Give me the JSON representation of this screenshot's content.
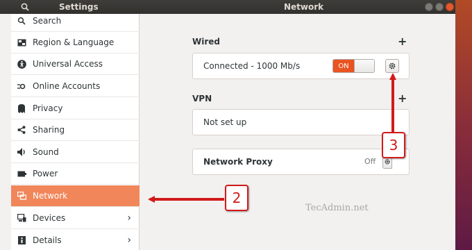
{
  "titlebar": {
    "app_title": "Settings",
    "panel_title": "Network"
  },
  "sidebar": {
    "items": [
      {
        "label": "Search",
        "icon": "search-icon"
      },
      {
        "label": "Region & Language",
        "icon": "region-icon"
      },
      {
        "label": "Universal Access",
        "icon": "universal-access-icon"
      },
      {
        "label": "Online Accounts",
        "icon": "online-accounts-icon"
      },
      {
        "label": "Privacy",
        "icon": "privacy-icon"
      },
      {
        "label": "Sharing",
        "icon": "sharing-icon"
      },
      {
        "label": "Sound",
        "icon": "sound-icon"
      },
      {
        "label": "Power",
        "icon": "power-icon"
      },
      {
        "label": "Network",
        "icon": "network-icon",
        "active": true
      },
      {
        "label": "Devices",
        "icon": "devices-icon",
        "chevron": "›"
      },
      {
        "label": "Details",
        "icon": "details-icon",
        "chevron": "›"
      }
    ]
  },
  "network": {
    "wired": {
      "title": "Wired",
      "add_label": "+",
      "status": "Connected - 1000 Mb/s",
      "toggle_label": "ON"
    },
    "vpn": {
      "title": "VPN",
      "add_label": "+",
      "status": "Not set up"
    },
    "proxy": {
      "title": "Network Proxy",
      "state": "Off"
    }
  },
  "watermark": "TecAdmin.net",
  "annotations": {
    "callout_2": "2",
    "callout_3": "3",
    "color": "#d11a1a"
  },
  "colors": {
    "accent": "#e95420",
    "active_row": "#f0865a"
  }
}
